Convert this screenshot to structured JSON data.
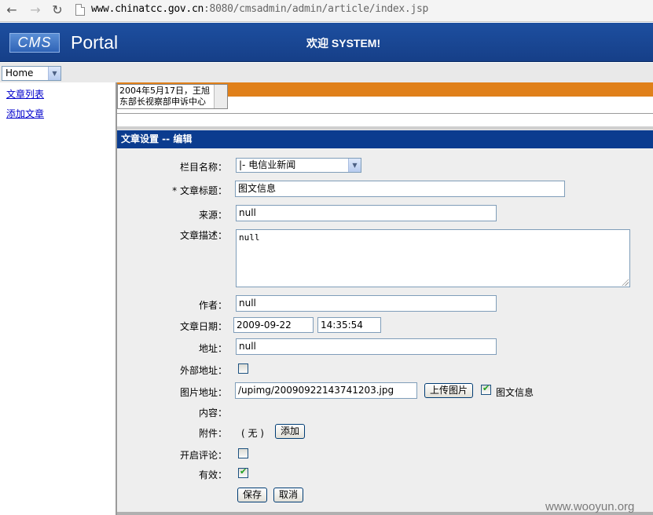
{
  "browser": {
    "url_host": "www.chinatcc.gov.cn",
    "url_rest": ":8080/cmsadmin/admin/article/index.jsp"
  },
  "header": {
    "logo": "CMS",
    "portal": "Portal",
    "welcome": "欢迎 SYSTEM!"
  },
  "top_select": {
    "value": "Home"
  },
  "sidebar": {
    "items": [
      {
        "label": "文章列表"
      },
      {
        "label": "添加文章"
      }
    ]
  },
  "preview_textarea": {
    "line1": "2004年5月17日，王旭",
    "line2": "东部长视察部申诉中心"
  },
  "panel": {
    "title": "文章设置 -- 编辑"
  },
  "form": {
    "column_label": "栏目名称：",
    "column_value": "|- 电信业新闻",
    "title_label": "* 文章标题：",
    "title_value": "图文信息",
    "source_label": "来源：",
    "source_value": "null",
    "desc_label": "文章描述：",
    "desc_value": "null",
    "author_label": "作者：",
    "author_value": "null",
    "date_label": "文章日期：",
    "date_value": "2009-09-22",
    "time_value": "14:35:54",
    "address_label": "地址：",
    "address_value": "null",
    "external_label": "外部地址：",
    "external_checked": false,
    "image_label": "图片地址：",
    "image_value": "/upimg/20090922143741203.jpg",
    "upload_button": "上传图片",
    "image_checkbox_label": "图文信息",
    "image_checked": true,
    "content_label": "内容：",
    "attachment_label": "附件：",
    "attachment_value": "( 无 )",
    "add_button": "添加",
    "comment_label": "开启评论：",
    "comment_checked": false,
    "valid_label": "有效：",
    "valid_checked": true,
    "save_button": "保存",
    "cancel_button": "取消"
  },
  "watermark": "www.wooyun.org"
}
